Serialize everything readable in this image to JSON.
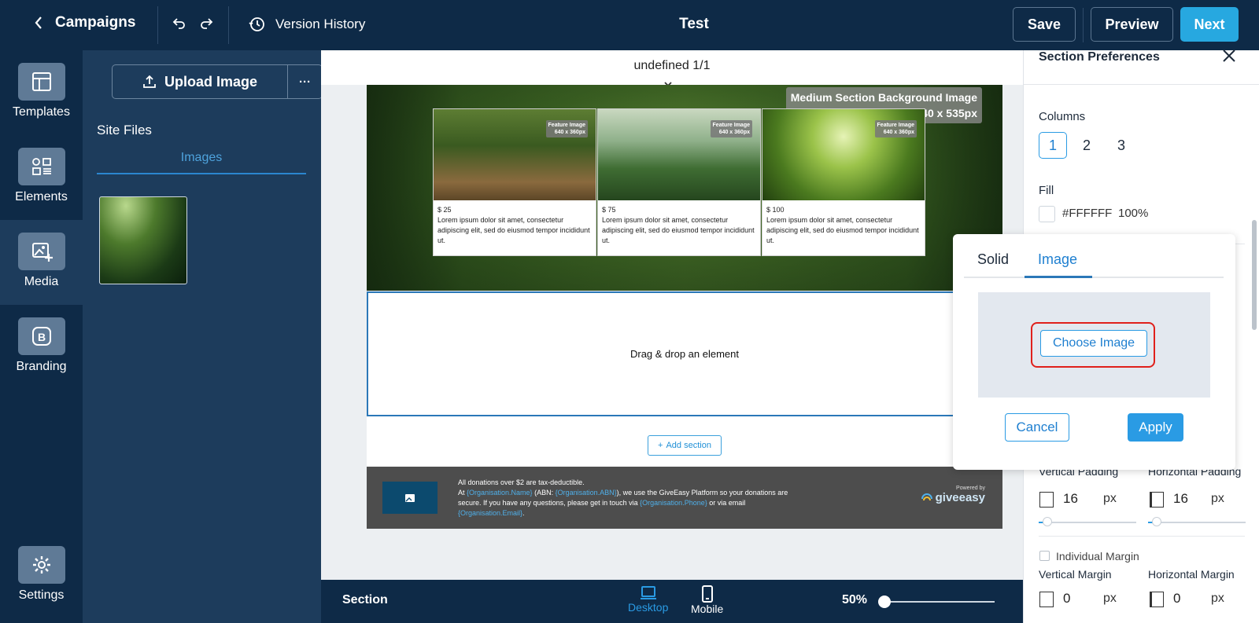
{
  "header": {
    "back_label": "Campaigns",
    "version_history": "Version History",
    "title": "Test",
    "save": "Save",
    "preview": "Preview",
    "next": "Next"
  },
  "nav": {
    "items": [
      {
        "label": "Templates",
        "icon": "templates-icon"
      },
      {
        "label": "Elements",
        "icon": "elements-icon"
      },
      {
        "label": "Media",
        "icon": "media-icon",
        "active": true
      },
      {
        "label": "Branding",
        "icon": "branding-icon"
      },
      {
        "label": "Settings",
        "icon": "gear-icon"
      }
    ]
  },
  "media_panel": {
    "upload_label": "Upload Image",
    "more_label": "···",
    "site_files": "Site Files",
    "images_tab": "Images"
  },
  "canvas": {
    "section_indicator": "undefined 1/1",
    "bg_label_line1": "Medium Section Background Image",
    "bg_label_line2": "1440 x 535px",
    "feature_label": "Feature Image",
    "feature_size": "640 x 360px",
    "cards": [
      {
        "price": "$ 25",
        "text": "Lorem ipsum dolor sit amet, consectetur adipiscing elit, sed do eiusmod tempor incididunt ut."
      },
      {
        "price": "$ 75",
        "text": "Lorem ipsum dolor sit amet, consectetur adipiscing elit, sed do eiusmod tempor incididunt ut."
      },
      {
        "price": "$ 100",
        "text": "Lorem ipsum dolor sit amet, consectetur adipiscing elit, sed do eiusmod tempor incididunt ut."
      }
    ],
    "dropzone": "Drag & drop an element",
    "add_section": "Add section",
    "footer": {
      "line1": "All donations over $2 are tax-deductible.",
      "line2_a": "At ",
      "org_name": "{Organisation.Name}",
      "line2_b": " (ABN: ",
      "org_abn": "{Organisation.ABN}",
      "line2_c": "), we use the GiveEasy Platform so your donations are secure. If you have any questions, please get in touch via ",
      "org_phone": "{Organisation.Phone}",
      "line2_d": " or via email ",
      "org_email": "{Organisation.Email}",
      "line2_e": ".",
      "powered_by": "Powered by",
      "brand": "giveeasy"
    }
  },
  "bottom_bar": {
    "section": "Section",
    "desktop": "Desktop",
    "mobile": "Mobile",
    "zoom": "50%"
  },
  "right_panel": {
    "title": "Section Preferences",
    "columns_label": "Columns",
    "columns": [
      "1",
      "2",
      "3"
    ],
    "fill_label": "Fill",
    "fill_hex": "#FFFFFF",
    "fill_opacity": "100%",
    "vertical_padding_label": "Vertical Padding",
    "horizontal_padding_label": "Horizontal Padding",
    "vertical_padding": "16",
    "horizontal_padding": "16",
    "unit": "px",
    "individual_margin": "Individual Margin",
    "vertical_margin_label": "Vertical Margin",
    "horizontal_margin_label": "Horizontal Margin",
    "vertical_margin": "0",
    "horizontal_margin": "0"
  },
  "popover": {
    "tab_solid": "Solid",
    "tab_image": "Image",
    "choose_image": "Choose Image",
    "cancel": "Cancel",
    "apply": "Apply"
  },
  "colors": {
    "navy": "#0e2a47",
    "panel": "#1d3c5c",
    "accent": "#2a9be4",
    "highlight_ring": "#e0201b"
  }
}
